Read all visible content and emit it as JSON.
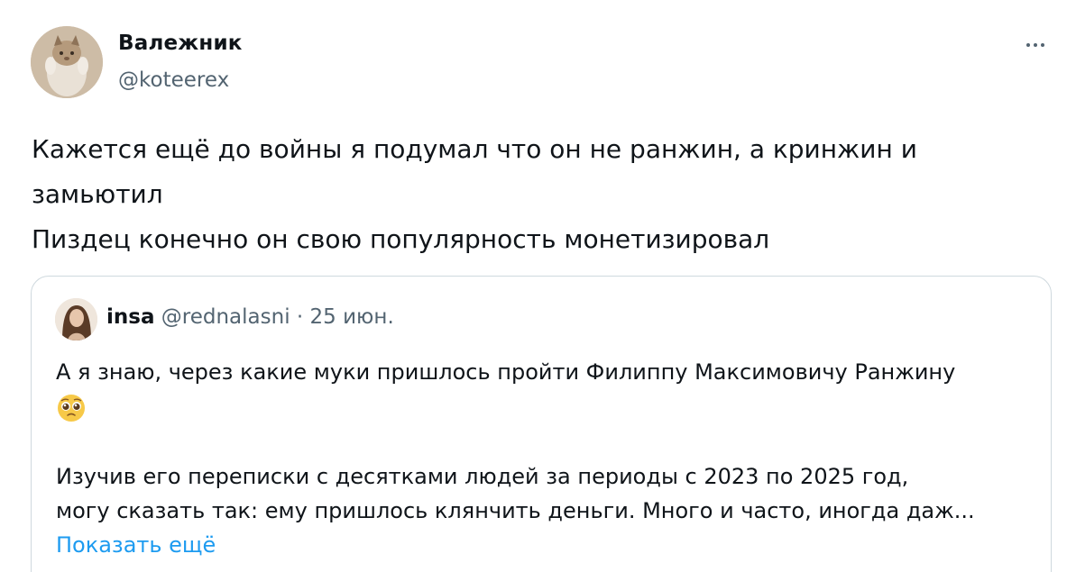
{
  "author": {
    "display_name": "Валежник",
    "handle": "@koteerex",
    "avatar_icon": "cat-avatar-icon"
  },
  "more_icon": "more-horizontal-icon",
  "tweet": {
    "lines": [
      "Кажется ещё до войны я подумал что он не ранжин, а кринжин и",
      "замьютил",
      "Пиздец конечно он свою популярность монетизировал"
    ]
  },
  "quote": {
    "display_name": "insa",
    "handle": "@rednalasni",
    "separator": "·",
    "date": "25 июн.",
    "avatar_icon": "person-avatar-icon",
    "line1": "А я знаю, через какие муки пришлось пройти Филиппу Максимовичу Ранжину",
    "emoji_icon": "pleading-face-icon",
    "line3": "Изучив его переписки с десятками людей за периоды с 2023 по 2025 год,",
    "line4": "могу сказать так: ему пришлось клянчить деньги. Много и часто, иногда даж...",
    "show_more": "Показать ещё"
  },
  "colors": {
    "text": "#0f1419",
    "secondary": "#536471",
    "link": "#1d9bf0",
    "border": "#cfd9de"
  }
}
